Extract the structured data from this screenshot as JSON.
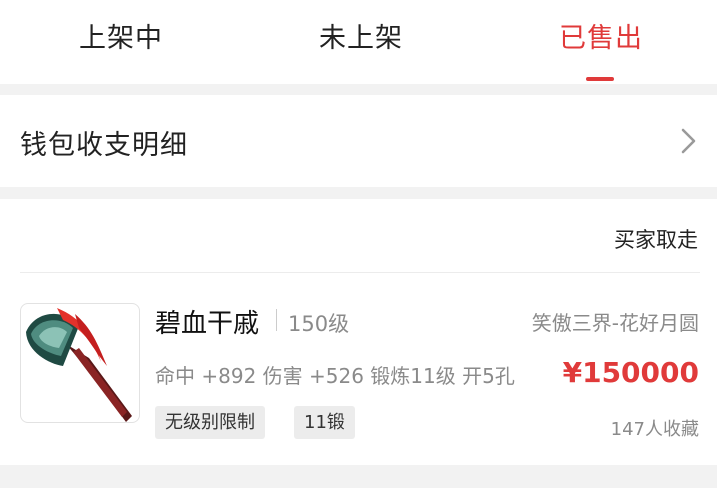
{
  "tabs": [
    {
      "label": "上架中",
      "active": false
    },
    {
      "label": "未上架",
      "active": false
    },
    {
      "label": "已售出",
      "active": true
    }
  ],
  "wallet": {
    "label": "钱包收支明细",
    "icon": "chevron-right-icon"
  },
  "item": {
    "status": "买家取走",
    "name": "碧血干戚",
    "level": "150级",
    "server": "笑傲三界-花好月圆",
    "stats": "命中 +892 伤害 +526 锻炼11级 开5孔",
    "price": "¥150000",
    "tags": [
      "无级别限制",
      "11锻"
    ],
    "favorites": "147人收藏",
    "image_icon": "axe-icon"
  },
  "colors": {
    "accent": "#e03a3a",
    "text": "#222222",
    "muted": "#8a8a8a",
    "background": "#f2f2f2"
  }
}
